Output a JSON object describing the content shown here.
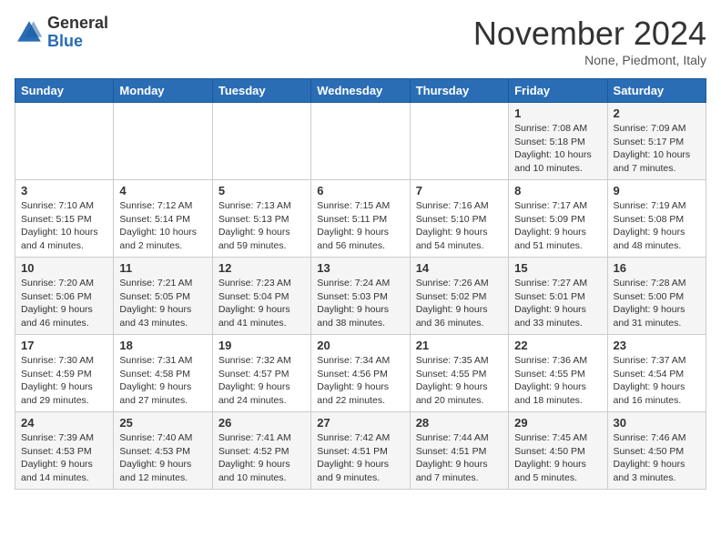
{
  "header": {
    "logo_general": "General",
    "logo_blue": "Blue",
    "month_title": "November 2024",
    "subtitle": "None, Piedmont, Italy"
  },
  "days_of_week": [
    "Sunday",
    "Monday",
    "Tuesday",
    "Wednesday",
    "Thursday",
    "Friday",
    "Saturday"
  ],
  "weeks": [
    [
      {
        "day": "",
        "info": ""
      },
      {
        "day": "",
        "info": ""
      },
      {
        "day": "",
        "info": ""
      },
      {
        "day": "",
        "info": ""
      },
      {
        "day": "",
        "info": ""
      },
      {
        "day": "1",
        "info": "Sunrise: 7:08 AM\nSunset: 5:18 PM\nDaylight: 10 hours and 10 minutes."
      },
      {
        "day": "2",
        "info": "Sunrise: 7:09 AM\nSunset: 5:17 PM\nDaylight: 10 hours and 7 minutes."
      }
    ],
    [
      {
        "day": "3",
        "info": "Sunrise: 7:10 AM\nSunset: 5:15 PM\nDaylight: 10 hours and 4 minutes."
      },
      {
        "day": "4",
        "info": "Sunrise: 7:12 AM\nSunset: 5:14 PM\nDaylight: 10 hours and 2 minutes."
      },
      {
        "day": "5",
        "info": "Sunrise: 7:13 AM\nSunset: 5:13 PM\nDaylight: 9 hours and 59 minutes."
      },
      {
        "day": "6",
        "info": "Sunrise: 7:15 AM\nSunset: 5:11 PM\nDaylight: 9 hours and 56 minutes."
      },
      {
        "day": "7",
        "info": "Sunrise: 7:16 AM\nSunset: 5:10 PM\nDaylight: 9 hours and 54 minutes."
      },
      {
        "day": "8",
        "info": "Sunrise: 7:17 AM\nSunset: 5:09 PM\nDaylight: 9 hours and 51 minutes."
      },
      {
        "day": "9",
        "info": "Sunrise: 7:19 AM\nSunset: 5:08 PM\nDaylight: 9 hours and 48 minutes."
      }
    ],
    [
      {
        "day": "10",
        "info": "Sunrise: 7:20 AM\nSunset: 5:06 PM\nDaylight: 9 hours and 46 minutes."
      },
      {
        "day": "11",
        "info": "Sunrise: 7:21 AM\nSunset: 5:05 PM\nDaylight: 9 hours and 43 minutes."
      },
      {
        "day": "12",
        "info": "Sunrise: 7:23 AM\nSunset: 5:04 PM\nDaylight: 9 hours and 41 minutes."
      },
      {
        "day": "13",
        "info": "Sunrise: 7:24 AM\nSunset: 5:03 PM\nDaylight: 9 hours and 38 minutes."
      },
      {
        "day": "14",
        "info": "Sunrise: 7:26 AM\nSunset: 5:02 PM\nDaylight: 9 hours and 36 minutes."
      },
      {
        "day": "15",
        "info": "Sunrise: 7:27 AM\nSunset: 5:01 PM\nDaylight: 9 hours and 33 minutes."
      },
      {
        "day": "16",
        "info": "Sunrise: 7:28 AM\nSunset: 5:00 PM\nDaylight: 9 hours and 31 minutes."
      }
    ],
    [
      {
        "day": "17",
        "info": "Sunrise: 7:30 AM\nSunset: 4:59 PM\nDaylight: 9 hours and 29 minutes."
      },
      {
        "day": "18",
        "info": "Sunrise: 7:31 AM\nSunset: 4:58 PM\nDaylight: 9 hours and 27 minutes."
      },
      {
        "day": "19",
        "info": "Sunrise: 7:32 AM\nSunset: 4:57 PM\nDaylight: 9 hours and 24 minutes."
      },
      {
        "day": "20",
        "info": "Sunrise: 7:34 AM\nSunset: 4:56 PM\nDaylight: 9 hours and 22 minutes."
      },
      {
        "day": "21",
        "info": "Sunrise: 7:35 AM\nSunset: 4:55 PM\nDaylight: 9 hours and 20 minutes."
      },
      {
        "day": "22",
        "info": "Sunrise: 7:36 AM\nSunset: 4:55 PM\nDaylight: 9 hours and 18 minutes."
      },
      {
        "day": "23",
        "info": "Sunrise: 7:37 AM\nSunset: 4:54 PM\nDaylight: 9 hours and 16 minutes."
      }
    ],
    [
      {
        "day": "24",
        "info": "Sunrise: 7:39 AM\nSunset: 4:53 PM\nDaylight: 9 hours and 14 minutes."
      },
      {
        "day": "25",
        "info": "Sunrise: 7:40 AM\nSunset: 4:53 PM\nDaylight: 9 hours and 12 minutes."
      },
      {
        "day": "26",
        "info": "Sunrise: 7:41 AM\nSunset: 4:52 PM\nDaylight: 9 hours and 10 minutes."
      },
      {
        "day": "27",
        "info": "Sunrise: 7:42 AM\nSunset: 4:51 PM\nDaylight: 9 hours and 9 minutes."
      },
      {
        "day": "28",
        "info": "Sunrise: 7:44 AM\nSunset: 4:51 PM\nDaylight: 9 hours and 7 minutes."
      },
      {
        "day": "29",
        "info": "Sunrise: 7:45 AM\nSunset: 4:50 PM\nDaylight: 9 hours and 5 minutes."
      },
      {
        "day": "30",
        "info": "Sunrise: 7:46 AM\nSunset: 4:50 PM\nDaylight: 9 hours and 3 minutes."
      }
    ]
  ]
}
